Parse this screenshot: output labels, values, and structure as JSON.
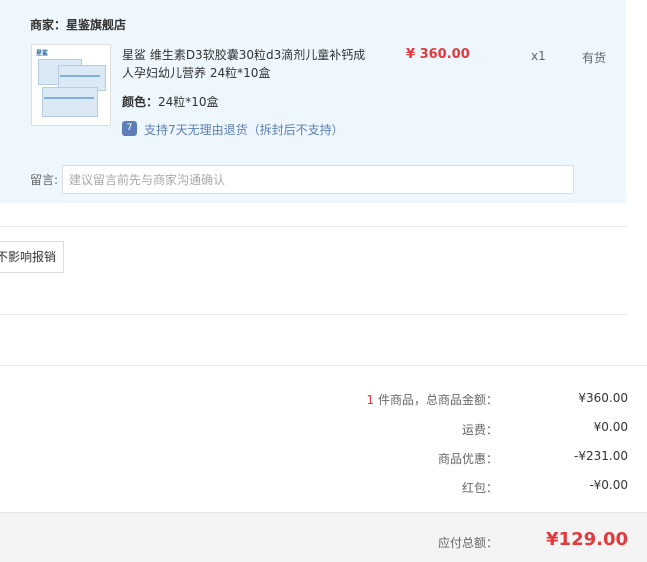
{
  "merchant": {
    "label": "商家：",
    "name": "星鉴旗舰店"
  },
  "product": {
    "thumb_brand": "星鲨",
    "title": "星鲨 维生素D3软胶囊30粒d3滴剂儿童补钙成人孕妇幼儿营养 24粒*10盒",
    "price": "¥ 360.00",
    "quantity": "x1",
    "stock": "有货",
    "color_label": "颜色：",
    "color_value": "24粒*10盒",
    "return_icon": "7",
    "return_policy": "支持7天无理由退货（拆封后不支持）"
  },
  "remark": {
    "label": "留言:",
    "placeholder": "建议留言前先与商家沟通确认"
  },
  "report_button": "不影响报销",
  "summary": {
    "item_count": "1",
    "item_count_suffix": " 件商品，总商品金额：",
    "total_goods": "¥360.00",
    "shipping_label": "运费：",
    "shipping": "¥0.00",
    "discount_label": "商品优惠：",
    "discount": "-¥231.00",
    "redpacket_label": "红包：",
    "redpacket": "-¥0.00"
  },
  "payment": {
    "label": "应付总额：",
    "amount": "¥129.00"
  },
  "colors": {
    "accent": "#e4393c",
    "panel_bg": "#eef7fd",
    "link": "#5d7fb7"
  }
}
